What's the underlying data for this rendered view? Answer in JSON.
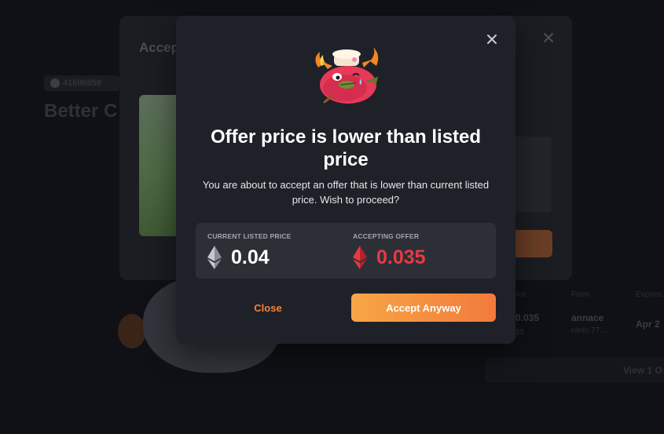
{
  "background": {
    "asset_id": "41696858",
    "asset_title": "Better C",
    "columns": [
      "Price",
      "From",
      "Expires"
    ],
    "offer_row": {
      "price": "0.035",
      "price_sub": "$5",
      "from": "annace",
      "from_sub": "ronin:77...",
      "expires": "Apr 2"
    },
    "view_all_label": "View 1 O"
  },
  "underlying_modal": {
    "title": "Accept"
  },
  "modal": {
    "title": "Offer price is lower than listed price",
    "description": "You are about to accept an offer that is lower than current listed price. Wish to proceed?",
    "current_listed_label": "CURRENT LISTED PRICE",
    "current_listed_value": "0.04",
    "accepting_offer_label": "ACCEPTING OFFER",
    "accepting_offer_value": "0.035",
    "close_label": "Close",
    "accept_label": "Accept Anyway",
    "icons": {
      "close": "close-icon",
      "listed_currency": "ethereum-icon",
      "offer_currency": "ethereum-icon",
      "mascot": "axie-mascot"
    }
  },
  "colors": {
    "modal_bg": "#1f2128",
    "price_box_bg": "#2d2f37",
    "accent_orange": "#f5813a",
    "offer_red": "#ea3943",
    "accept_gradient_start": "#f7a646",
    "accept_gradient_end": "#f27a3c"
  }
}
